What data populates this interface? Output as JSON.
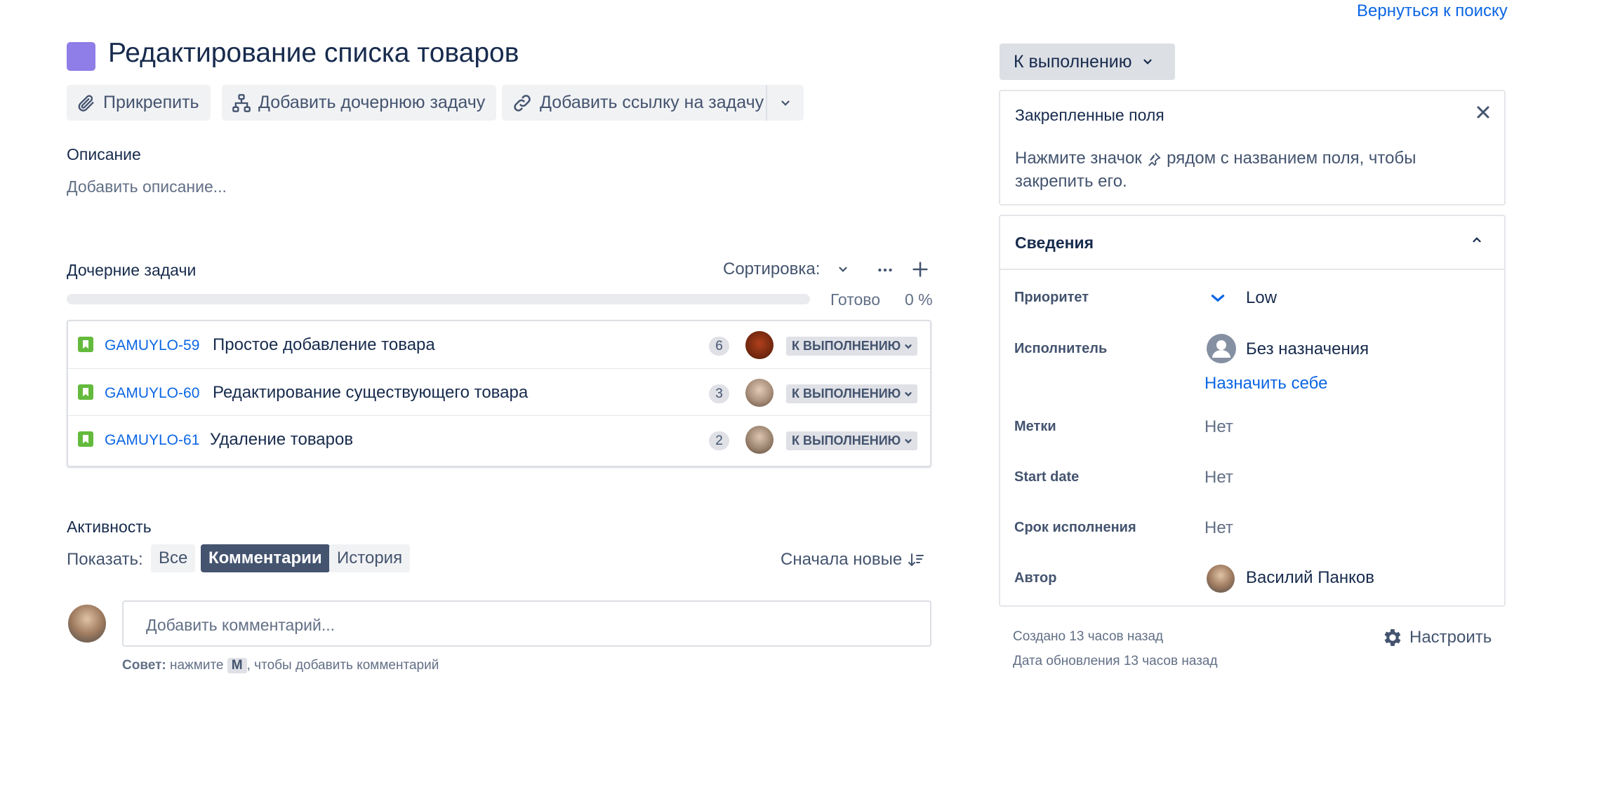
{
  "header": {
    "back_link": "Вернуться к поиску",
    "title": "Редактирование списка товаров"
  },
  "toolbar": {
    "attach": "Прикрепить",
    "add_child": "Добавить дочернюю задачу",
    "add_link": "Добавить ссылку на задачу"
  },
  "description": {
    "heading": "Описание",
    "placeholder": "Добавить описание..."
  },
  "child_issues": {
    "heading": "Дочерние задачи",
    "sort_label": "Сортировка:",
    "done_label": "Готово",
    "done_percent": "0 %",
    "progress": 0,
    "items": [
      {
        "key": "GAMUYLO-59",
        "summary": "Простое добавление товара",
        "count": "6",
        "status": "К ВЫПОЛНЕНИЮ",
        "avatar_color": "#7a2a10"
      },
      {
        "key": "GAMUYLO-60",
        "summary": "Редактирование существующего товара",
        "count": "3",
        "status": "К ВЫПОЛНЕНИЮ",
        "avatar_color": "#a88e7a"
      },
      {
        "key": "GAMUYLO-61",
        "summary": "Удаление товаров",
        "count": "2",
        "status": "К ВЫПОЛНЕНИЮ",
        "avatar_color": "#9c8570"
      }
    ]
  },
  "activity": {
    "heading": "Активность",
    "show_label": "Показать:",
    "filters": [
      {
        "label": "Все",
        "active": false
      },
      {
        "label": "Комментарии",
        "active": true
      },
      {
        "label": "История",
        "active": false
      }
    ],
    "sort_label": "Сначала новые",
    "comment_placeholder": "Добавить комментарий...",
    "tip_bold": "Совет:",
    "tip_before": "нажмите",
    "tip_key": "M",
    "tip_after": ", чтобы добавить комментарий"
  },
  "sidebar": {
    "status_button": "К выполнению",
    "pinned": {
      "title": "Закрепленные поля",
      "text_before": "Нажмите значок",
      "text_after": "рядом с названием поля, чтобы",
      "text_line2": "закрепить его."
    },
    "details": {
      "title": "Сведения",
      "priority_label": "Приоритет",
      "priority_value": "Low",
      "assignee_label": "Исполнитель",
      "assignee_value": "Без назначения",
      "assign_self": "Назначить себе",
      "labels_label": "Метки",
      "labels_value": "Нет",
      "start_label": "Start date",
      "start_value": "Нет",
      "due_label": "Срок исполнения",
      "due_value": "Нет",
      "reporter_label": "Автор",
      "reporter_value": "Василий Панков"
    },
    "created": "Создано 13 часов назад",
    "updated": "Дата обновления 13 часов назад",
    "configure": "Настроить"
  },
  "colors": {
    "accent": "#0c66e4",
    "title_icon": "#8f7ee7",
    "story_icon": "#63ba3c"
  }
}
